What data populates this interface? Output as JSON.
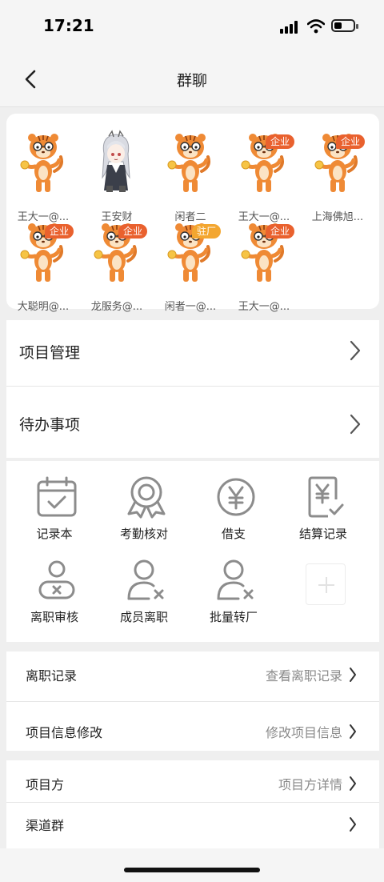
{
  "status": {
    "time": "17:21"
  },
  "header": {
    "title": "群聊"
  },
  "members": [
    {
      "name": "王大一@...",
      "badge": "",
      "avatar": "tiger"
    },
    {
      "name": "王安财",
      "badge": "",
      "avatar": "anime"
    },
    {
      "name": "闲者二",
      "badge": "",
      "avatar": "tiger"
    },
    {
      "name": "王大一@...",
      "badge": "企业",
      "avatar": "tiger"
    },
    {
      "name": "上海佛旭...",
      "badge": "企业",
      "avatar": "tiger"
    },
    {
      "name": "大聪明@...",
      "badge": "企业",
      "avatar": "tiger"
    },
    {
      "name": "龙服务@...",
      "badge": "企业",
      "avatar": "tiger"
    },
    {
      "name": "闲者一@...",
      "badge": "驻厂",
      "avatar": "tiger"
    },
    {
      "name": "王大一@...",
      "badge": "企业",
      "avatar": "tiger"
    }
  ],
  "menu": {
    "project_management": "项目管理",
    "todo": "待办事项"
  },
  "tools": [
    {
      "label": "记录本",
      "icon": "calendar-check-icon"
    },
    {
      "label": "考勤核对",
      "icon": "medal-icon"
    },
    {
      "label": "借支",
      "icon": "yen-circle-icon"
    },
    {
      "label": "结算记录",
      "icon": "yen-document-icon"
    },
    {
      "label": "离职审核",
      "icon": "user-x-icon"
    },
    {
      "label": "成员离职",
      "icon": "user-remove-icon"
    },
    {
      "label": "批量转厂",
      "icon": "user-transfer-icon"
    }
  ],
  "settings": {
    "resign_record": {
      "label": "离职记录",
      "value": "查看离职记录"
    },
    "project_edit": {
      "label": "项目信息修改",
      "value": "修改项目信息"
    },
    "project_party": {
      "label": "项目方",
      "value": "项目方详情"
    },
    "channel_group": {
      "label": "渠道群",
      "value": ""
    }
  },
  "colors": {
    "badge_company": "#e9612e",
    "badge_resident": "#f3a630",
    "icon_gray": "#8c8c8c"
  }
}
